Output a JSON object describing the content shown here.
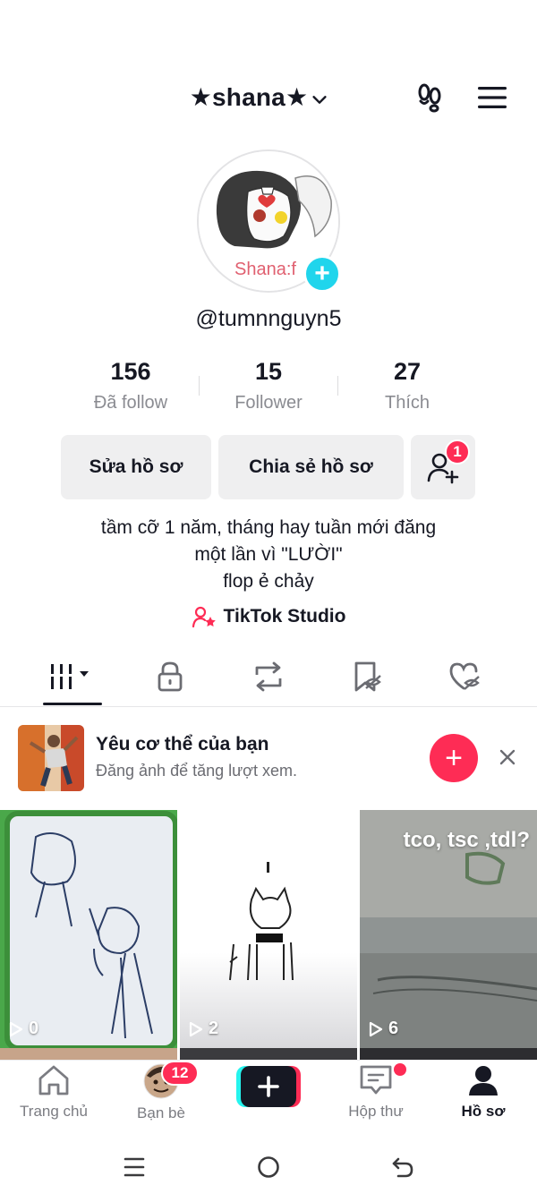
{
  "header": {
    "title": "★shana★",
    "chevron_icon": "chevron-down-icon",
    "footprints_icon": "footprints-icon",
    "menu_icon": "hamburger-menu-icon"
  },
  "profile": {
    "avatar_text": "Shana:f",
    "username": "@tumnnguyn5"
  },
  "stats": [
    {
      "value": "156",
      "label": "Đã follow"
    },
    {
      "value": "15",
      "label": "Follower"
    },
    {
      "value": "27",
      "label": "Thích"
    }
  ],
  "actions": {
    "edit_profile": "Sửa hồ sơ",
    "share_profile": "Chia sẻ hồ sơ",
    "add_friend_badge": "1"
  },
  "bio": {
    "line1": "tầm cỡ 1 năm, tháng hay tuần mới đăng",
    "line2": "một lần vì \"LƯỜI\"",
    "line3": "flop ẻ chảy"
  },
  "studio_link": "TikTok Studio",
  "tabs": [
    "videos-grid",
    "private-lock",
    "reposts",
    "favorites",
    "liked"
  ],
  "promo": {
    "title": "Yêu cơ thể của bạn",
    "subtitle": "Đăng ảnh để tăng lượt xem."
  },
  "videos": [
    {
      "views": "0",
      "caption": ""
    },
    {
      "views": "2",
      "caption": ""
    },
    {
      "views": "6",
      "caption": "tco, tsc ,tdl?"
    }
  ],
  "bottom_nav": [
    {
      "label": "Trang chủ",
      "icon": "home-icon"
    },
    {
      "label": "Bạn bè",
      "icon": "friends-avatar",
      "badge": "12"
    },
    {
      "label": "",
      "icon": "create-icon"
    },
    {
      "label": "Hộp thư",
      "icon": "inbox-icon"
    },
    {
      "label": "Hồ sơ",
      "icon": "profile-icon"
    }
  ],
  "colors": {
    "accent": "#fe2c55",
    "cyan": "#20d5ec",
    "text": "#161823",
    "muted": "#8a8b91"
  }
}
